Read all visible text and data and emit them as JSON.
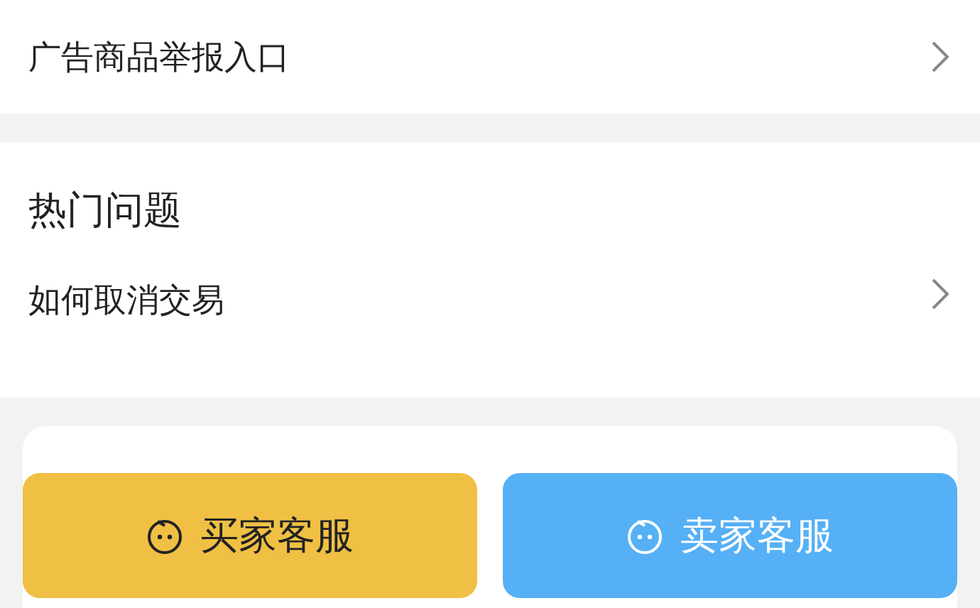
{
  "top_row": {
    "label": "广告商品举报入口"
  },
  "faq": {
    "title": "热门问题",
    "items": [
      {
        "label": "如何取消交易"
      }
    ]
  },
  "buttons": [
    {
      "label": "买家客服",
      "kind": "buyer"
    },
    {
      "label": "卖家客服",
      "kind": "seller"
    }
  ]
}
